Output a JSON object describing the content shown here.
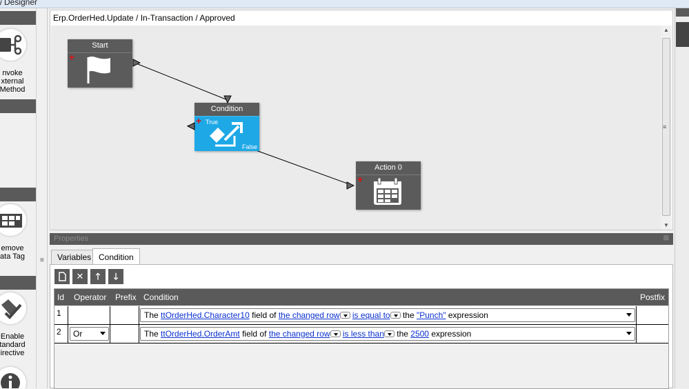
{
  "window": {
    "title": "w Designer"
  },
  "toolbox": {
    "items": [
      {
        "label_lines": [
          "nvoke",
          "xternal",
          "Method"
        ],
        "icon": "invoke-external-method-icon"
      },
      {
        "label_lines": [
          "emove",
          "ata Tag"
        ],
        "icon": "remove-data-tag-icon"
      },
      {
        "label_lines": [
          "Enable",
          "tandard",
          "irective"
        ],
        "icon": "enable-standard-directive-icon"
      },
      {
        "label_lines": [],
        "icon": "info-icon"
      }
    ]
  },
  "designer": {
    "breadcrumb": "Erp.OrderHed.Update / In-Transaction / Approved",
    "nodes": {
      "start": {
        "title": "Start",
        "icon": "flag-icon"
      },
      "condition": {
        "title": "Condition",
        "true_label": "True",
        "false_label": "False",
        "icon": "condition-arrow-icon"
      },
      "action": {
        "title": "Action 0",
        "icon": "calendar-icon"
      }
    }
  },
  "properties": {
    "header": "Properties",
    "tabs": [
      {
        "label": "Variables",
        "active": false
      },
      {
        "label": "Condition",
        "active": true
      }
    ],
    "toolbar": [
      "new-icon",
      "delete-icon",
      "move-up-icon",
      "move-down-icon"
    ],
    "columns": {
      "id": "Id",
      "operator": "Operator",
      "prefix": "Prefix",
      "condition": "Condition",
      "postfix": "Postfix"
    },
    "rows": [
      {
        "id": "1",
        "operator": "",
        "condition": {
          "t1": "The",
          "field": "ttOrderHed.Character10",
          "t2": "field of",
          "source": "the changed row",
          "comparison": "is equal to",
          "t3": "the",
          "value": "\"Punch\"",
          "t4": "expression"
        }
      },
      {
        "id": "2",
        "operator": "Or",
        "condition": {
          "t1": "The",
          "field": "ttOrderHed.OrderAmt",
          "t2": "field of",
          "source": "the changed row",
          "comparison": "is less than",
          "t3": "the",
          "value": "2500",
          "t4": "expression"
        }
      }
    ]
  },
  "colors": {
    "node_header": "#5b5b5b",
    "condition_body": "#1ea8e6",
    "link": "#0a30d0",
    "plus": "#e01010"
  }
}
